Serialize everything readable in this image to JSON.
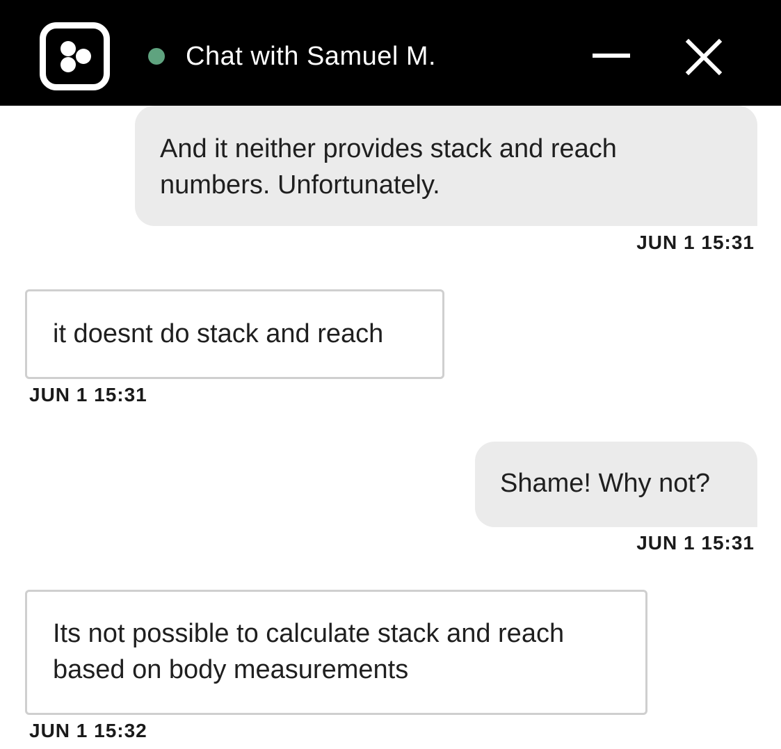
{
  "header": {
    "title": "Chat with Samuel M.",
    "status_color": "#5fa37f",
    "logo_icon": "chat-logo-icon",
    "minimize_icon": "minimize-icon",
    "close_icon": "close-icon"
  },
  "messages": [
    {
      "direction": "outgoing",
      "text": "And it neither provides stack and reach numbers. Unfortunately.",
      "timestamp": "JUN 1 15:31"
    },
    {
      "direction": "incoming",
      "text": "it doesnt do stack and reach",
      "timestamp": "JUN 1 15:31"
    },
    {
      "direction": "outgoing",
      "text": "Shame! Why not?",
      "timestamp": "JUN 1 15:31"
    },
    {
      "direction": "incoming",
      "text": "Its not possible to calculate stack and reach based on body measurements",
      "timestamp": "JUN 1 15:32"
    }
  ],
  "colors": {
    "header_bg": "#000000",
    "outgoing_bubble": "#ebebeb",
    "incoming_border": "#cfcfcf"
  }
}
